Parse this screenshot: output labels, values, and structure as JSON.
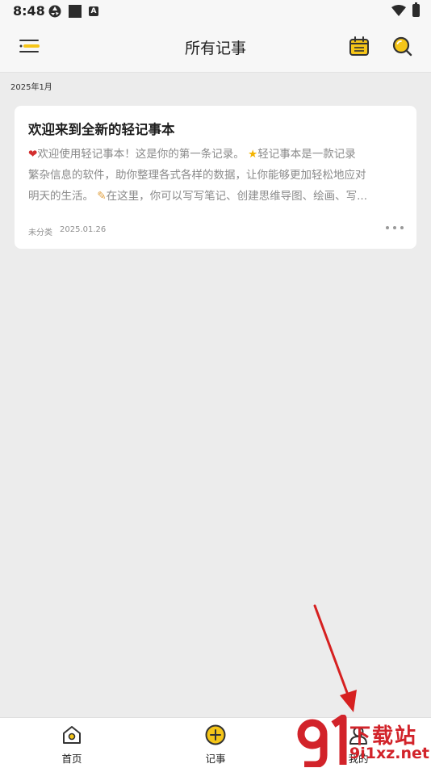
{
  "status_bar": {
    "time": "8:48",
    "icons": [
      "aperture-icon",
      "square-icon",
      "a-badge-icon",
      "wifi-icon",
      "battery-icon"
    ]
  },
  "header": {
    "title": "所有记事",
    "icons": [
      "menu-icon",
      "calendar-icon",
      "search-icon"
    ]
  },
  "group_label": "2025年1月",
  "note": {
    "title": "欢迎来到全新的轻记事本",
    "lines": [
      "欢迎使用轻记事本！这是你的第一条记录。",
      "轻记事本是一款记录",
      "繁杂信息的软件，助你整理各式各样的数据，让你能够更加轻松地应对",
      "明天的生活。",
      "在这里，你可以写写笔记、创建思维导图、绘画、写..."
    ],
    "category": "未分类",
    "date": "2025.01.26"
  },
  "bottom_nav": {
    "items": [
      {
        "label": "首页",
        "icon": "home-icon"
      },
      {
        "label": "记事",
        "icon": "add-circle-icon"
      },
      {
        "label": "我的",
        "icon": "user-icon"
      }
    ]
  },
  "watermark": {
    "cn": "下载站",
    "domain": "9i1xz.net"
  },
  "colors": {
    "accent": "#f5c518",
    "background": "#ececec",
    "annotation_arrow": "#d62020",
    "watermark": "#d2232a"
  }
}
